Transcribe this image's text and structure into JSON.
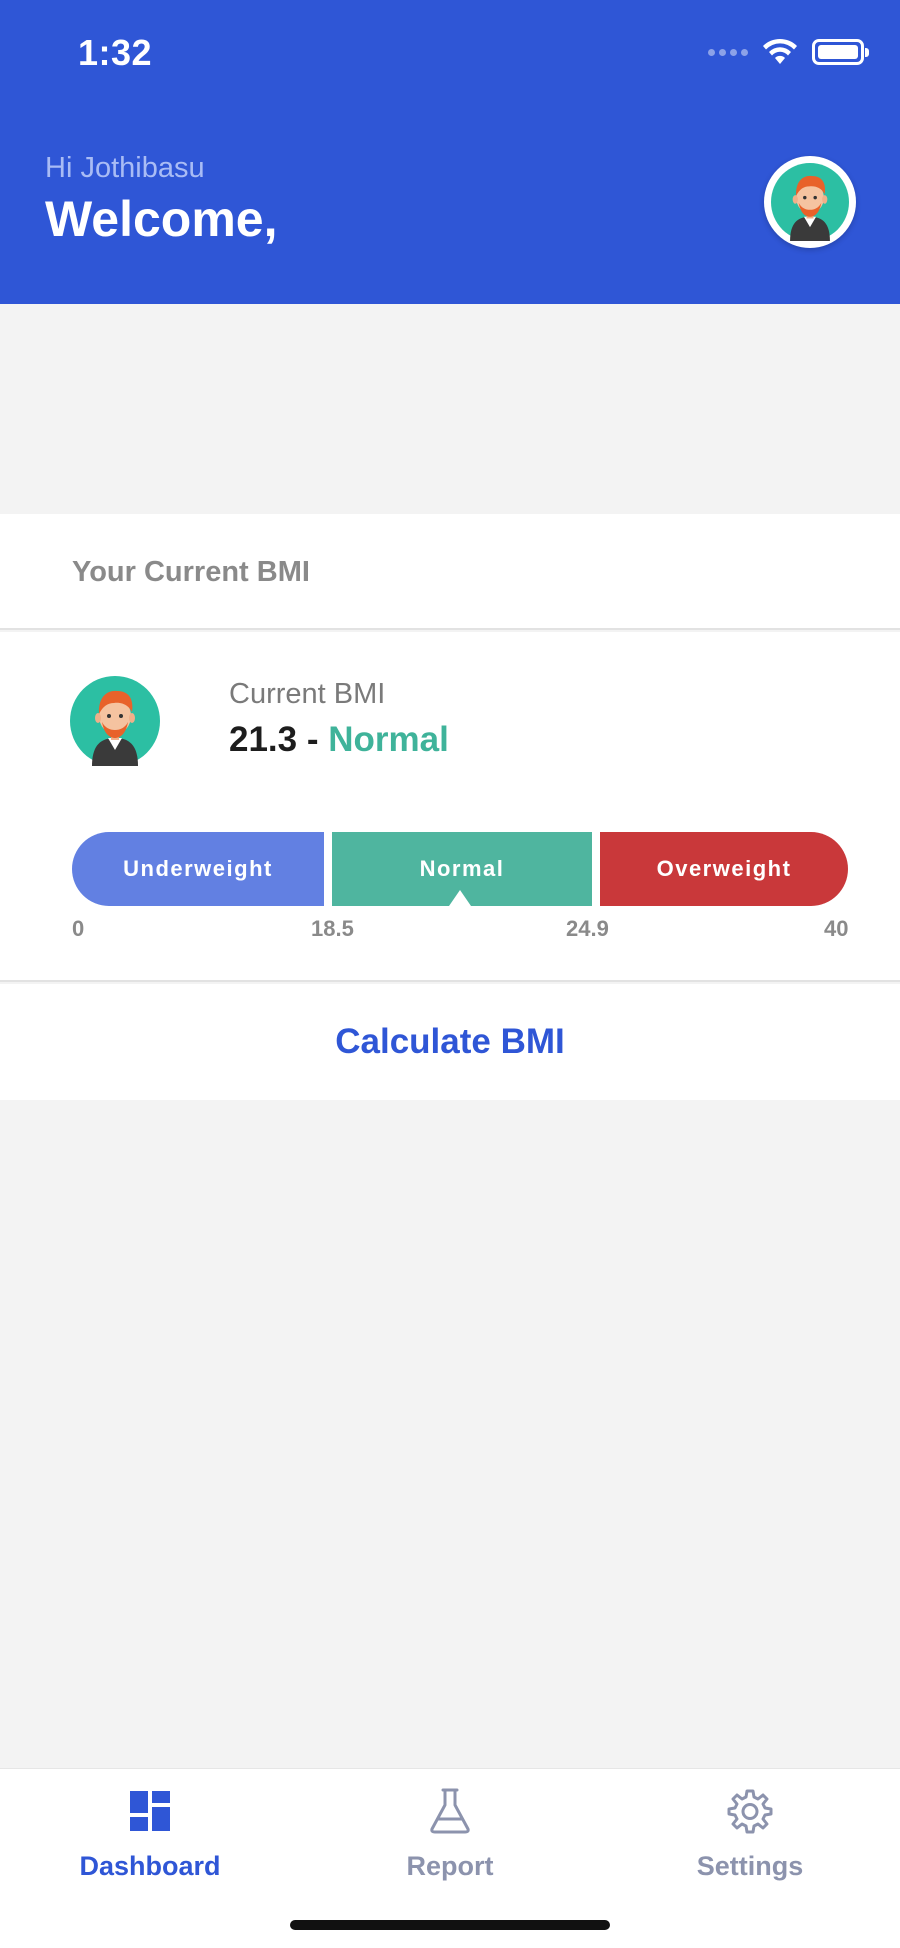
{
  "status_bar": {
    "time": "1:32"
  },
  "header": {
    "greeting": "Hi Jothibasu",
    "welcome": "Welcome,"
  },
  "bmi_card": {
    "title": "Your Current BMI",
    "current_label": "Current BMI",
    "value": "21.3",
    "separator": " - ",
    "status": "Normal",
    "scale": {
      "segments": [
        {
          "label": "Underweight",
          "color": "#6280e2"
        },
        {
          "label": "Normal",
          "color": "#4fb59f"
        },
        {
          "label": "Overweight",
          "color": "#c9383a"
        }
      ],
      "ticks": [
        "0",
        "18.5",
        "24.9",
        "40"
      ]
    },
    "calculate_label": "Calculate BMI"
  },
  "tabbar": {
    "tabs": [
      {
        "label": "Dashboard",
        "icon": "dashboard-icon",
        "active": true
      },
      {
        "label": "Report",
        "icon": "flask-icon",
        "active": false
      },
      {
        "label": "Settings",
        "icon": "gear-icon",
        "active": false
      }
    ]
  },
  "colors": {
    "primary": "#2f56d6",
    "normal": "#3fb39a",
    "inactive_tab": "#8c93ad"
  }
}
